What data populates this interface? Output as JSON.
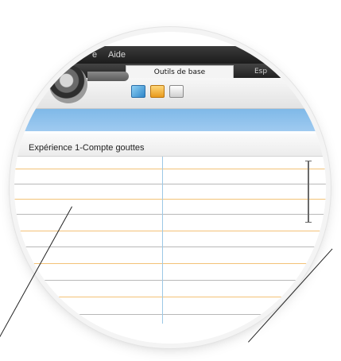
{
  "menubar": {
    "items": [
      "e",
      "Aide"
    ]
  },
  "tabs": [
    {
      "label": "Outils de base",
      "active": true
    },
    {
      "label": "Esp",
      "active": false
    }
  ],
  "toolbar": {
    "tools": [
      "new-document-icon",
      "open-folder-icon",
      "print-icon"
    ]
  },
  "document": {
    "title": "Expérience 1-Compte gouttes"
  },
  "colors": {
    "menubar": "#2b2b2b",
    "band": "#8fc3ee",
    "grid_orange": "#f3c277",
    "grid_gray": "#b8b8b8",
    "grid_blue": "#9cc8e6"
  }
}
